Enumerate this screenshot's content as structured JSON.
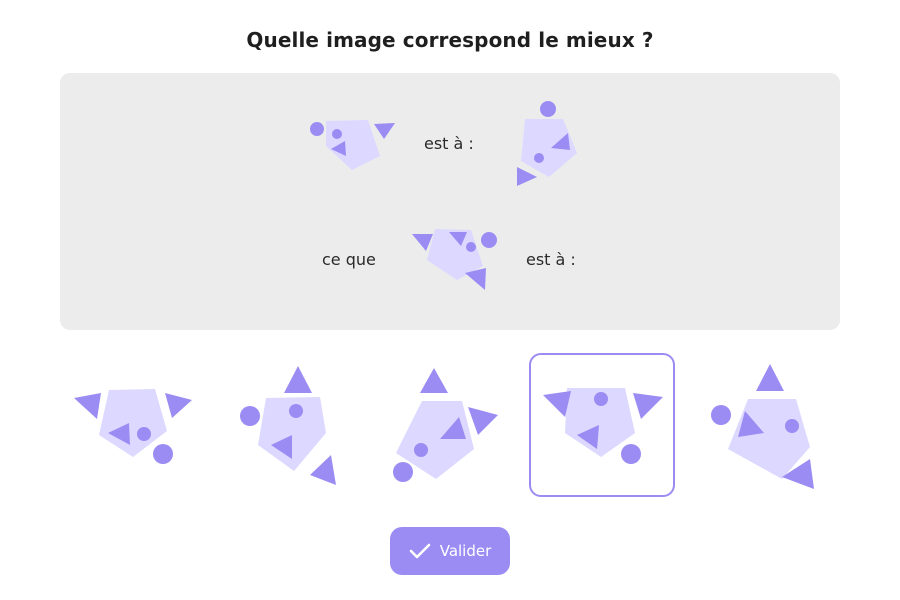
{
  "question": "Quelle image correspond le mieux ?",
  "analogy": {
    "is_to_1": "est à :",
    "as": "ce que",
    "is_to_2": "est à :"
  },
  "colors": {
    "panel_background": "#ececec",
    "pentagon_fill": "#dcd8ff",
    "accent_fill": "#9b8cf4",
    "selection_border": "#9b8cf4"
  },
  "options": {
    "count": 5,
    "selected_index": 4
  },
  "submit_button": {
    "label": "Valider",
    "icon": "check-icon"
  }
}
